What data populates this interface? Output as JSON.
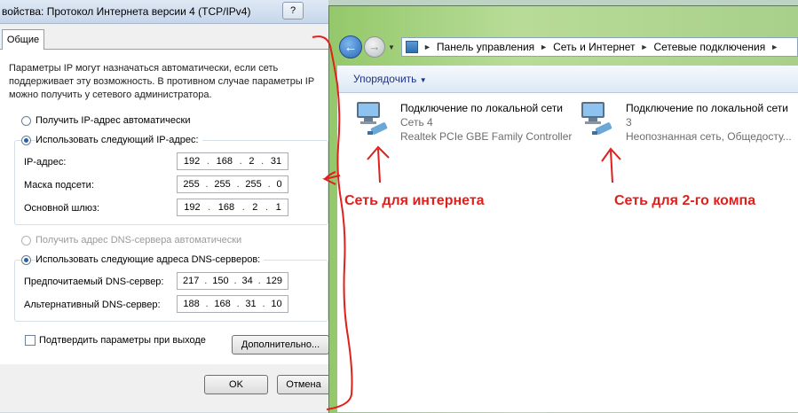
{
  "dialog": {
    "title": "войства: Протокол Интернета версии 4 (TCP/IPv4)",
    "help_label": "?",
    "tab_general": "Общие",
    "intro_text": "Параметры IP могут назначаться автоматически, если сеть поддерживает эту возможность. В противном случае параметры IP можно получить у сетевого администратора.",
    "radio_ip_auto": "Получить IP-адрес автоматически",
    "radio_ip_manual": "Использовать следующий IP-адрес:",
    "ip_label": "IP-адрес:",
    "ip_value": [
      "192",
      "168",
      "2",
      "31"
    ],
    "mask_label": "Маска подсети:",
    "mask_value": [
      "255",
      "255",
      "255",
      "0"
    ],
    "gateway_label": "Основной шлюз:",
    "gateway_value": [
      "192",
      "168",
      "2",
      "1"
    ],
    "radio_dns_auto": "Получить адрес DNS-сервера автоматически",
    "radio_dns_manual": "Использовать следующие адреса DNS-серверов:",
    "dns_pref_label": "Предпочитаемый DNS-сервер:",
    "dns_pref_value": [
      "217",
      "150",
      "34",
      "129"
    ],
    "dns_alt_label": "Альтернативный DNS-сервер:",
    "dns_alt_value": [
      "188",
      "168",
      "31",
      "10"
    ],
    "validate_label": "Подтвердить параметры при выходе",
    "advanced_button": "Дополнительно...",
    "ok_button": "OK",
    "cancel_button": "Отмена"
  },
  "explorer": {
    "breadcrumb": [
      "Панель управления",
      "Сеть и Интернет",
      "Сетевые подключения"
    ],
    "organize_label": "Упорядочить",
    "connections": [
      {
        "name": "Подключение по локальной сети",
        "network": "Сеть  4",
        "device": "Realtek PCIe GBE Family Controller"
      },
      {
        "name": "Подключение по локальной сети",
        "network": "3",
        "device": "Неопознанная сеть, Общедосту..."
      }
    ]
  },
  "annotations": {
    "label_left": "Сеть для интернета",
    "label_right": "Сеть для 2-го компа",
    "color": "#e0201c"
  }
}
